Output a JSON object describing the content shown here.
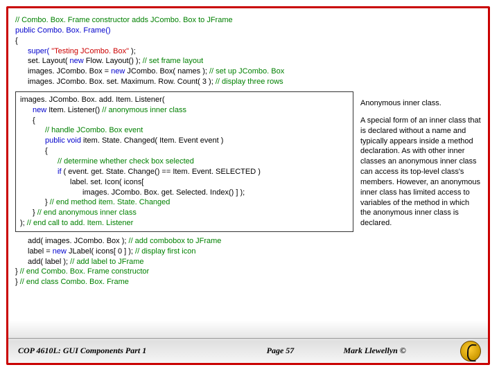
{
  "code": {
    "top": {
      "l1": "// Combo. Box. Frame constructor adds JCombo. Box to JFrame",
      "l2": "public Combo. Box. Frame()",
      "l3": "{",
      "l4_a": "super(",
      "l4_b": " \"Testing JCombo. Box\" ",
      "l4_c": ");",
      "l5_a": "set. Layout(",
      "l5_b": " new ",
      "l5_c": "Flow. Layout() );",
      "l5_d": " // set frame layout",
      "l6_a": "images. JCombo. Box = ",
      "l6_b": "new ",
      "l6_c": "JCombo. Box( names );",
      "l6_d": " // set up JCombo. Box",
      "l7_a": "images. JCombo. Box. set. Maximum. Row. Count( ",
      "l7_b": "3",
      "l7_c": " );",
      "l7_d": " // display three rows"
    },
    "mid": {
      "m1": "images. JCombo. Box. add. Item. Listener(",
      "m2_a": "new ",
      "m2_b": "Item. Listener()",
      "m2_c": " // anonymous inner class",
      "m3": "{",
      "m4": "// handle JCombo. Box event",
      "m5_a": "public void ",
      "m5_b": "item. State. Changed( Item. Event event )",
      "m6": "{",
      "m7": "// determine whether check box selected",
      "m8_a": "if",
      "m8_b": " ( event. get. State. Change() == Item. Event. SELECTED )",
      "m9": "label. set. Icon( icons[",
      "m10": "images. JCombo. Box. get. Selected. Index() ] );",
      "m11_a": "}",
      "m11_b": " // end method item. State. Changed",
      "m12_a": "}",
      "m12_b": " // end anonymous inner class",
      "m13_a": ");",
      "m13_b": " // end call to add. Item. Listener"
    },
    "bot": {
      "b1_a": "add( images. JCombo. Box );",
      "b1_b": " // add combobox to JFrame",
      "b2_a": "label = ",
      "b2_b": "new ",
      "b2_c": "JLabel( icons[ ",
      "b2_d": "0",
      "b2_e": " ] );",
      "b2_f": " // display first icon",
      "b3_a": "add( label );",
      "b3_b": " // add label to JFrame",
      "b4_a": "}",
      "b4_b": " // end Combo. Box. Frame constructor",
      "b5_a": "}",
      "b5_b": " // end class Combo. Box. Frame"
    }
  },
  "annotation": {
    "title": "Anonymous inner class.",
    "body": "A special form of an inner class that is declared without a name and typically appears inside a method declaration.  As with other inner classes an anonymous inner class can access its top-level class's members.  However, an anonymous inner class has limited access to variables of the method in which the anonymous inner class is declared."
  },
  "footer": {
    "left": "COP 4610L: GUI Components Part 1",
    "center": "Page 57",
    "right": "Mark Llewellyn ©"
  }
}
